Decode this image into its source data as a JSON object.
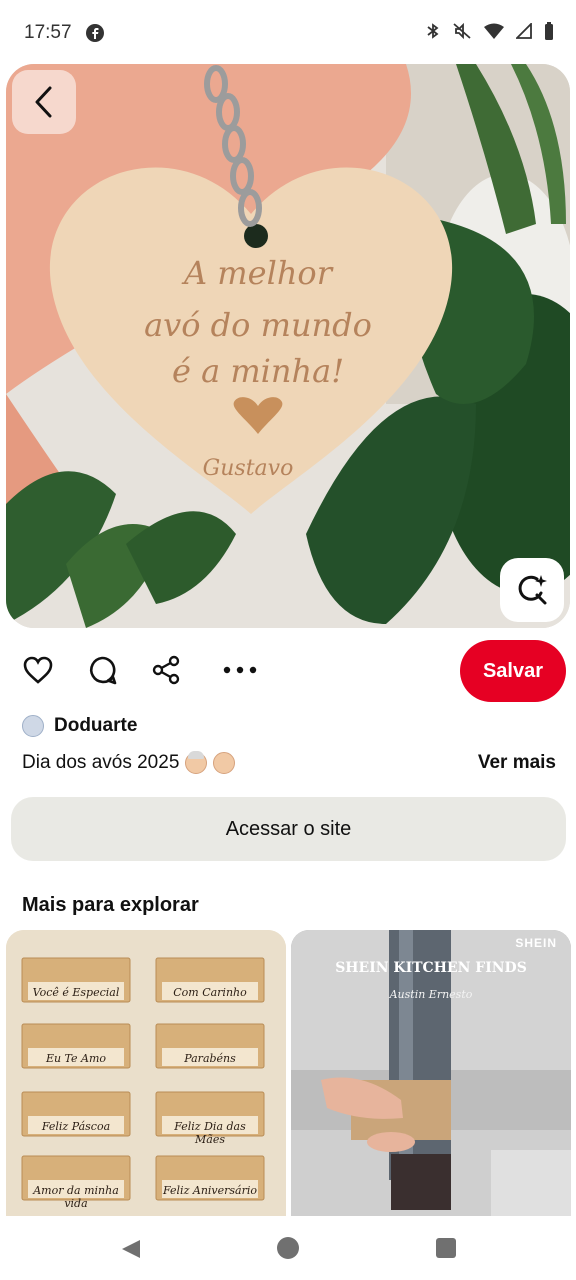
{
  "status_bar": {
    "time": "17:57",
    "left_icon": "facebook-icon",
    "right_icons": [
      "bluetooth-icon",
      "mute-icon",
      "wifi-icon",
      "signal-icon",
      "battery-icon"
    ]
  },
  "pin": {
    "image_text": {
      "line1": "A melhor",
      "line2": "avó do mundo",
      "line3": "é a minha!",
      "signature": "Gustavo"
    },
    "author": "Doduarte",
    "description": "Dia dos avós 2025",
    "see_more": "Ver mais",
    "visit_site": "Acessar o site",
    "save_label": "Salvar"
  },
  "explore": {
    "title": "Mais para explorar",
    "card1_labels": [
      "Você é Especial",
      "Com Carinho",
      "Eu Te Amo",
      "Parabéns",
      "Feliz Páscoa",
      "Feliz Dia das Mães",
      "Amor da minha vida",
      "Feliz Aniversário"
    ],
    "card2": {
      "brand": "SHEIN",
      "headline": "SHEIN KITCHEN FINDS",
      "subline": "Austin Ernesto"
    }
  },
  "colors": {
    "accent": "#e60023",
    "button_bg": "#e9e9e4"
  }
}
